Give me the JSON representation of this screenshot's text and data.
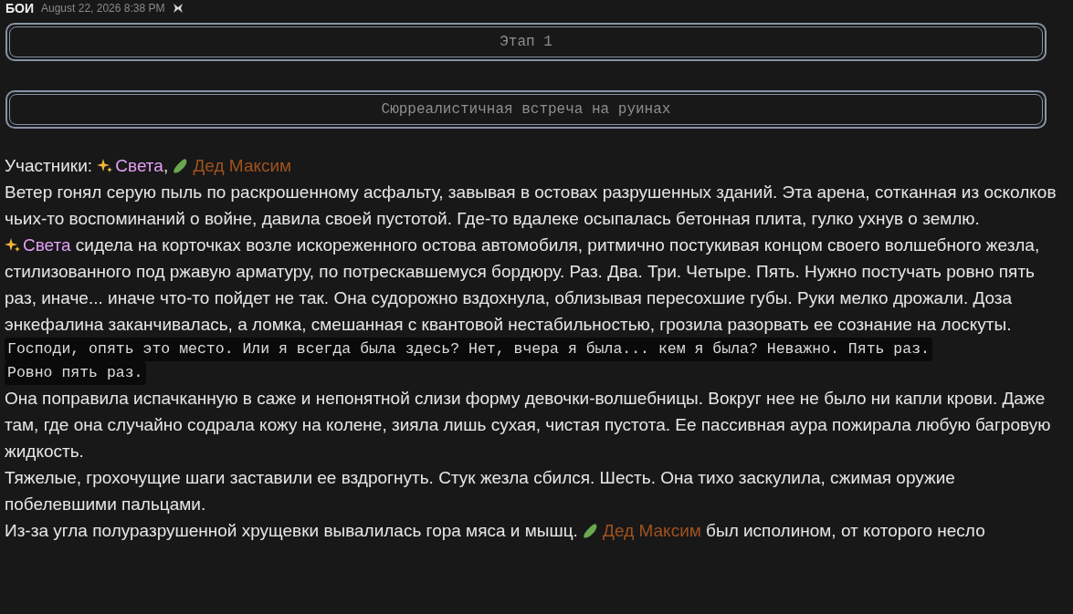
{
  "message": {
    "author": "БОИ",
    "time": "August 22, 2026 8:38 PM"
  },
  "boxes": [
    "Этап 1",
    "Сюрреалистичная встреча на руинах"
  ],
  "paragraphs": [
    [
      {
        "kind": "text",
        "text": "Участники: "
      },
      {
        "kind": "sparkle-mention",
        "text": "Света",
        "color": "#e39ff6"
      },
      {
        "kind": "text",
        "text": ", "
      },
      {
        "kind": "cucumber-mention",
        "text": "Дед Максим",
        "color": "#a0521e"
      }
    ],
    [
      {
        "kind": "text",
        "text": "Ветер гонял серую пыль по раскрошенному асфальту, завывая в остовах разрушенных зданий. Эта арена, сотканная из осколков чьих-то воспоминаний о войне, давила своей пустотой. Где-то вдалеке осыпалась бетонная плита, гулко ухнув о землю."
      }
    ],
    [
      {
        "kind": "sparkle-mention",
        "text": "Света",
        "color": "#e39ff6"
      },
      {
        "kind": "text",
        "text": " сидела на корточках возле искореженного остова автомобиля, ритмично постукивая концом своего волшебного жезла, стилизованного под ржавую арматуру, по потрескавшемуся бордюру. Раз. Два. Три. Четыре. Пять. Нужно постучать ровно пять раз, иначе... иначе что-то пойдет не так. Она судорожно вздохнула, облизывая пересохшие губы. Руки мелко дрожали. Доза энкефалина заканчивалась, а ломка, смешанная с квантовой нестабильностью, грозила разорвать ее сознание на лоскуты."
      }
    ],
    [
      {
        "kind": "code",
        "lines": [
          "Господи, опять это место. Или я всегда была здесь? Нет, вчера я была... кем я была? Неважно. Пять раз.",
          "Ровно пять раз."
        ]
      }
    ],
    [
      {
        "kind": "text",
        "text": "Она поправила испачканную в саже и непонятной слизи форму девочки-волшебницы. Вокруг нее не было ни капли крови. Даже там, где она случайно содрала кожу на колене, зияла лишь сухая, чистая пустота. Ее пассивная аура пожирала любую багровую жидкость."
      }
    ],
    [
      {
        "kind": "text",
        "text": "Тяжелые, грохочущие шаги заставили ее вздрогнуть. Стук жезла сбился. Шесть. Она тихо заскулила, сжимая оружие побелевшими пальцами."
      }
    ],
    [
      {
        "kind": "text",
        "text": "Из-за угла полуразрушенной хрущевки вывалилась гора мяса и мышц. "
      },
      {
        "kind": "cucumber-mention",
        "text": "Дед Максим",
        "color": "#a0521e"
      },
      {
        "kind": "text",
        "text": " был исполином, от которого несло"
      }
    ]
  ]
}
